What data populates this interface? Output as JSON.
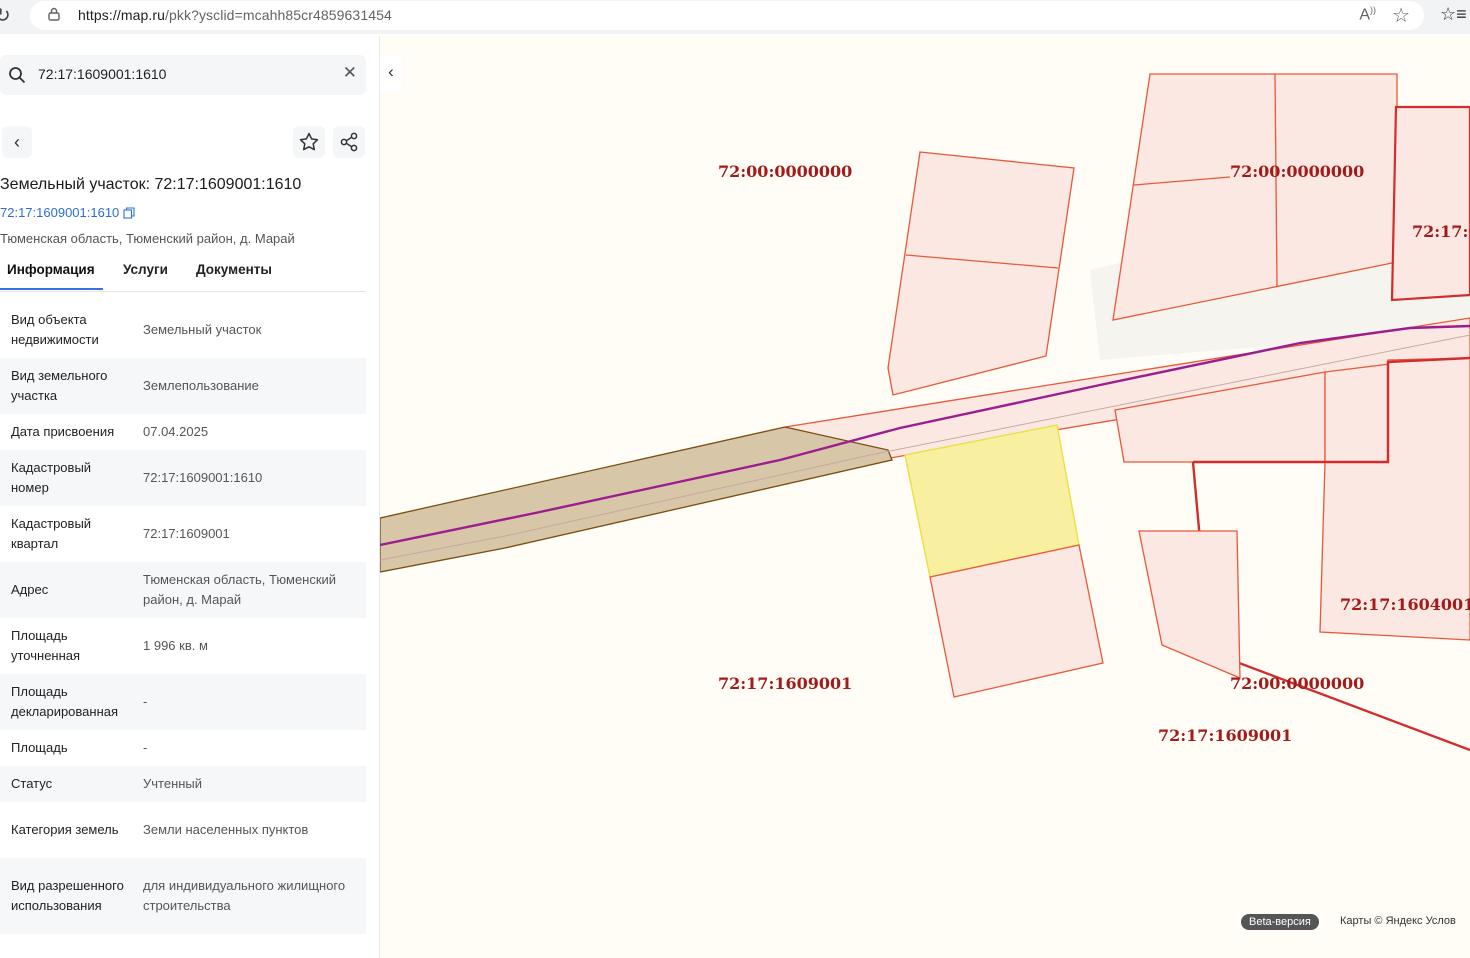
{
  "browser": {
    "url_host": "https://map.ru",
    "url_path": "/pkk?ysclid=mcahh85cr4859631454"
  },
  "search": {
    "query": "72:17:1609001:1610"
  },
  "object": {
    "title": "Земельный участок: 72:17:1609001:1610",
    "cadastral_link": "72:17:1609001:1610",
    "address": "Тюменская область, Тюменский район, д. Марай"
  },
  "tabs": [
    {
      "label": "Информация"
    },
    {
      "label": "Услуги"
    },
    {
      "label": "Документы"
    }
  ],
  "properties": [
    {
      "label": "Вид объекта недвижимости",
      "value": "Земельный участок"
    },
    {
      "label": "Вид земельного участка",
      "value": "Землепользование"
    },
    {
      "label": "Дата присвоения",
      "value": "07.04.2025"
    },
    {
      "label": "Кадастровый номер",
      "value": "72:17:1609001:1610"
    },
    {
      "label": "Кадастровый квартал",
      "value": "72:17:1609001"
    },
    {
      "label": "Адрес",
      "value": "Тюменская область, Тюменский район, д. Марай"
    },
    {
      "label": "Площадь уточненная",
      "value": "1 996 кв. м"
    },
    {
      "label": "Площадь декларированная",
      "value": "-"
    },
    {
      "label": "Площадь",
      "value": "-"
    },
    {
      "label": "Статус",
      "value": "Учтенный"
    },
    {
      "label": "Категория земель",
      "value": "Земли населенных пунктов"
    },
    {
      "label": "Вид разрешенного использования",
      "value": "для индивидуального жилищного строительства"
    }
  ],
  "map": {
    "labels": [
      "72:00:0000000",
      "72:00:0000000",
      "72:17:",
      "72:17:1604001",
      "72:17:1609001",
      "72:00:0000000",
      "72:17:1609001"
    ],
    "beta": "Beta-версия",
    "copyright": "Карты © Яндекс   Услов"
  },
  "colors": {
    "accent": "#2a6fd6",
    "parcel_fill": "#fce8e2",
    "parcel_stroke": "#e8583a",
    "selected_fill": "#f8f0a0",
    "road_line": "#9b1e8e",
    "label": "#a21a1a"
  }
}
